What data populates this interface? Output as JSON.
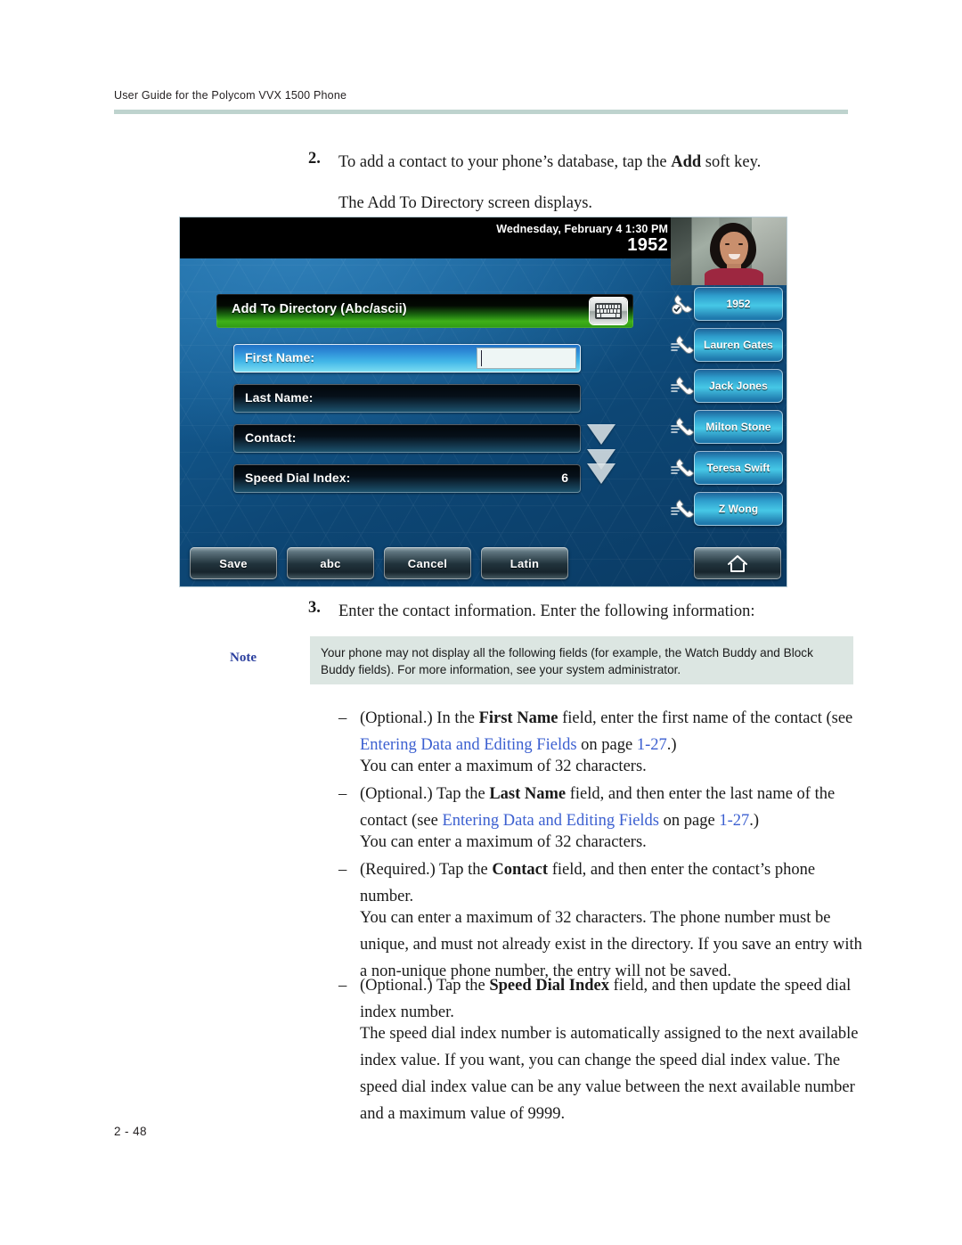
{
  "header": {
    "running_head": "User Guide for the Polycom VVX 1500 Phone"
  },
  "footer": {
    "page_number": "2 - 48"
  },
  "steps": {
    "step2": {
      "number": "2.",
      "text_before_bold": "To add a contact to your phone’s database, tap the ",
      "bold": "Add",
      "text_after_bold": " soft key.",
      "sub": "The Add To Directory screen displays."
    },
    "step3": {
      "number": "3.",
      "text": "Enter the contact information. Enter the following information:"
    }
  },
  "note": {
    "label": "Note",
    "text": "Your phone may not display all the following fields (for example, the Watch Buddy and Block Buddy fields). For more information, see your system administrator."
  },
  "bullets": [
    {
      "dash": "–",
      "lead": "(Optional.) In the ",
      "bold": "First Name",
      "mid": " field, enter the first name of the contact (see ",
      "link": "Entering Data and Editing Fields",
      "mid2": " on page ",
      "link2": "1-27",
      "tail": ".)",
      "para": "You can enter a maximum of 32 characters."
    },
    {
      "dash": "–",
      "lead": "(Optional.) Tap the ",
      "bold": "Last Name",
      "mid": " field, and then enter the last name of the contact (see ",
      "link": "Entering Data and Editing Fields",
      "mid2": " on page ",
      "link2": "1-27",
      "tail": ".)",
      "para": "You can enter a maximum of 32 characters."
    },
    {
      "dash": "–",
      "lead": "(Required.) Tap the ",
      "bold": "Contact",
      "mid": " field, and then enter the contact’s phone number.",
      "link": "",
      "mid2": "",
      "link2": "",
      "tail": "",
      "para": "You can enter a maximum of 32 characters. The phone number must be unique, and must not already exist in the directory. If you save an entry with a non-unique phone number, the entry will not be saved."
    },
    {
      "dash": "–",
      "lead": "(Optional.) Tap the ",
      "bold": "Speed Dial Index",
      "mid": " field, and then update the speed dial index number.",
      "link": "",
      "mid2": "",
      "link2": "",
      "tail": "",
      "para": "The speed dial index number is automatically assigned to the next available index value. If you want, you can change the speed dial index value. The speed dial index value can be any value between the next available number and a maximum value of 9999."
    }
  ],
  "phone": {
    "status": {
      "date_time": "Wednesday, February 4  1:30 PM",
      "extension": "1952"
    },
    "title_bar": {
      "title": "Add To Directory (Abc/ascii)",
      "keyboard_icon": "keyboard-icon"
    },
    "fields": [
      {
        "label": "First Name:",
        "value": "",
        "state": "active"
      },
      {
        "label": "Last Name:",
        "value": "",
        "state": "inactive"
      },
      {
        "label": "Contact:",
        "value": "",
        "state": "inactive"
      },
      {
        "label": "Speed Dial Index:",
        "value": "6",
        "state": "inactive"
      }
    ],
    "line_keys": [
      {
        "label": "1952",
        "icon": "handset-registered-icon"
      },
      {
        "label": "Lauren Gates",
        "icon": "handset-icon"
      },
      {
        "label": "Jack Jones",
        "icon": "handset-icon"
      },
      {
        "label": "Milton Stone",
        "icon": "handset-icon"
      },
      {
        "label": "Teresa Swift",
        "icon": "handset-icon"
      },
      {
        "label": "Z Wong",
        "icon": "handset-icon"
      }
    ],
    "soft_keys": [
      "Save",
      "abc",
      "Cancel",
      "Latin"
    ],
    "home_key_icon": "home-icon"
  },
  "colors": {
    "rule": "#bed3ce",
    "note_bg": "#dce6e2",
    "note_label": "#2b3f9e",
    "xref": "#3b5fd0",
    "title_bar_green": "#3fb019",
    "line_key_blue": "#46c8e6"
  }
}
